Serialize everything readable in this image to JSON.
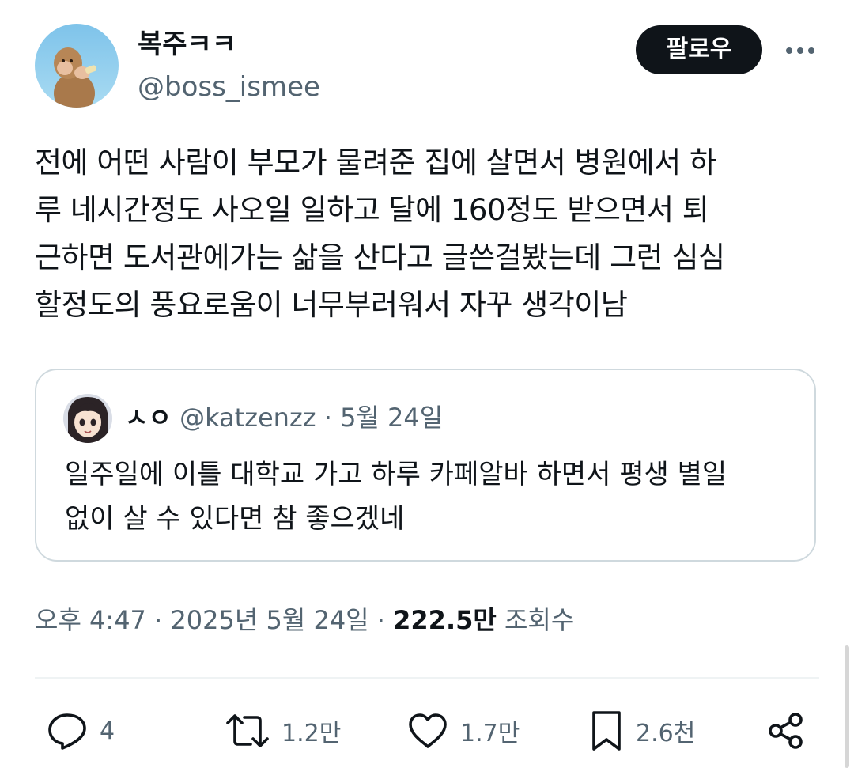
{
  "author": {
    "display_name": "복주ㅋㅋ",
    "handle": "@boss_ismee"
  },
  "follow_button": "팔로우",
  "tweet_text": "전에 어떤 사람이 부모가 물려준 집에 살면서 병원에서 하\n루 네시간정도 사오일 일하고 달에 160정도 받으면서 퇴\n근하면 도서관에가는 삶을 산다고 글쓴걸봤는데 그런 심심\n할정도의 풍요로움이 너무부러워서 자꾸 생각이남",
  "quoted": {
    "display_name": "ㅅㅇ",
    "handle": "@katzenzz",
    "separator": "·",
    "date": "5월 24일",
    "text": "일주일에 이틀 대학교 가고 하루 카페알바 하면서 평생 별일\n없이 살 수 있다면 참 좋으겠네"
  },
  "meta": {
    "time": "오후 4:47",
    "separator": "·",
    "date": "2025년 5월 24일",
    "views_count": "222.5만",
    "views_label": "조회수"
  },
  "actions": {
    "replies": "4",
    "retweets": "1.2만",
    "likes": "1.7만",
    "bookmarks": "2.6천"
  },
  "icons": {
    "more": "more-horizontal-icon",
    "reply": "reply-icon",
    "retweet": "retweet-icon",
    "like": "heart-icon",
    "bookmark": "bookmark-icon",
    "share": "share-icon"
  },
  "colors": {
    "text": "#0f1419",
    "secondary": "#536471",
    "border": "#cfd9de",
    "button_bg": "#0f1419",
    "button_text": "#ffffff"
  }
}
